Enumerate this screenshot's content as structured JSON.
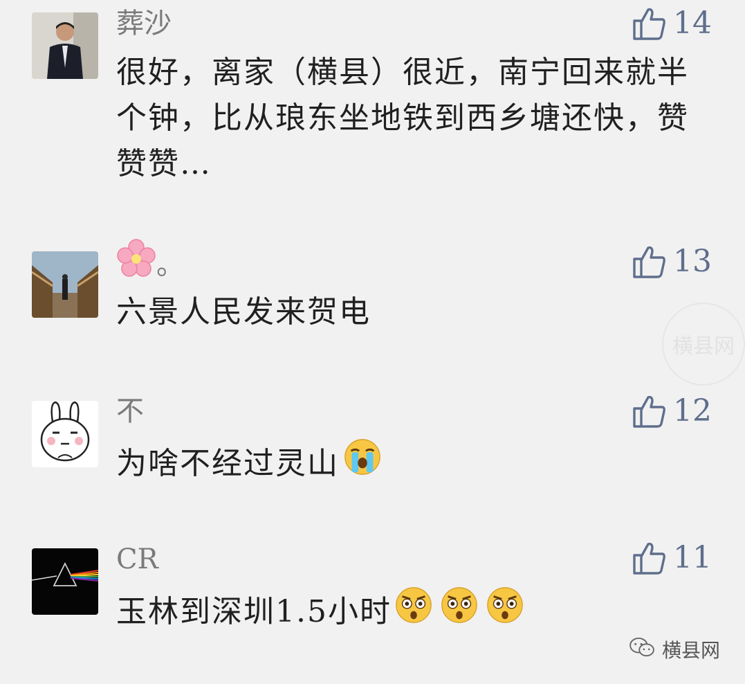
{
  "comments": [
    {
      "name": "葬沙",
      "text": "很好，离家（横县）很近，南宁回来就半个钟，比从琅东坐地铁到西乡塘还快，赞赞赞…",
      "likes": "14",
      "avatar": "man-in-suit-photo"
    },
    {
      "name": "。",
      "name_emoji": "cherry-blossom-icon",
      "text": "六景人民发来贺电",
      "likes": "13",
      "avatar": "bridge-photo"
    },
    {
      "name": "不",
      "text": "为啥不经过灵山",
      "text_emoji": "loudly-crying-face-icon",
      "likes": "12",
      "avatar": "cartoon-bunny"
    },
    {
      "name": "CR",
      "text": "玉林到深圳1.5小时",
      "text_emoji": "astonished-face-icon",
      "likes": "11",
      "avatar": "prism-album-art"
    }
  ],
  "footer": {
    "brand": "横县网",
    "icon": "wechat-official-account-icon"
  },
  "watermark": {
    "text": "横县网"
  },
  "colors": {
    "background": "#f1f1f1",
    "like": "#5f6e8c",
    "name": "#7a7a7a",
    "text": "#202020"
  }
}
